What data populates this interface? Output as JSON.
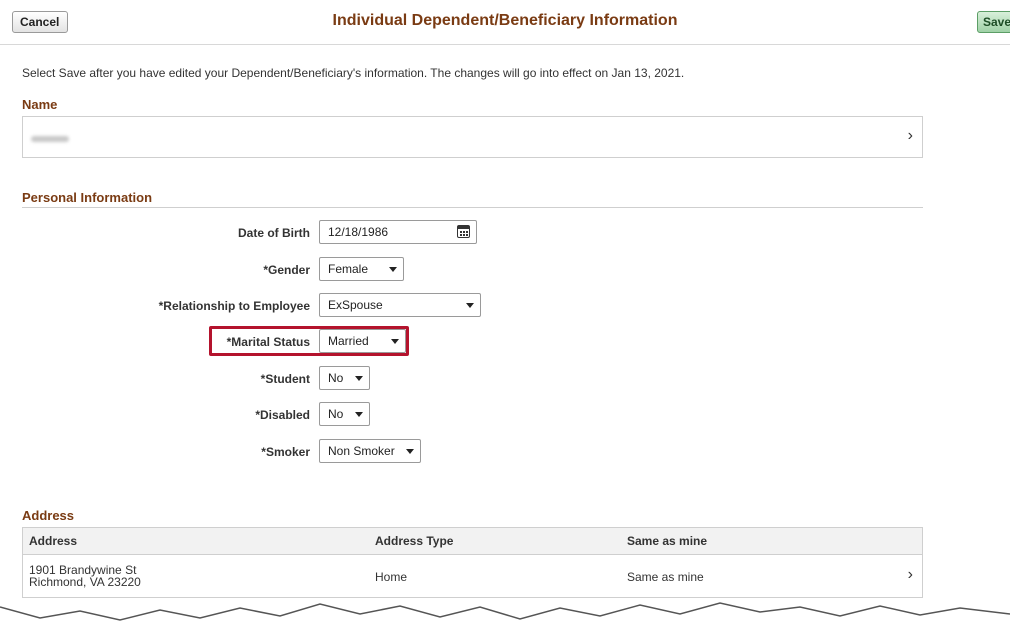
{
  "header": {
    "cancel_label": "Cancel",
    "title": "Individual Dependent/Beneficiary Information",
    "save_label": "Save"
  },
  "instructions": "Select Save after you have edited your Dependent/Beneficiary's information.  The changes will go into effect on Jan 13, 2021.",
  "name_section": {
    "heading": "Name"
  },
  "personal": {
    "heading": "Personal Information",
    "fields": {
      "dob": {
        "label": "Date of Birth",
        "value": "12/18/1986"
      },
      "gender": {
        "label": "*Gender",
        "value": "Female"
      },
      "relationship": {
        "label": "*Relationship to Employee",
        "value": "ExSpouse"
      },
      "marital": {
        "label": "*Marital Status",
        "value": "Married"
      },
      "student": {
        "label": "*Student",
        "value": "No"
      },
      "disabled": {
        "label": "*Disabled",
        "value": "No"
      },
      "smoker": {
        "label": "*Smoker",
        "value": "Non Smoker"
      }
    }
  },
  "address": {
    "heading": "Address",
    "columns": [
      "Address",
      "Address Type",
      "Same as mine"
    ],
    "rows": [
      {
        "line1": "1901 Brandywine St",
        "line2": "Richmond, VA 23220",
        "type": "Home",
        "same": "Same as mine"
      }
    ]
  },
  "icons": {
    "calendar": "calendar-icon",
    "chevron": "chevron-right-icon"
  },
  "colors": {
    "heading": "#7a3b13",
    "highlight": "#b4132d",
    "save_button": "#9fd1a6"
  }
}
